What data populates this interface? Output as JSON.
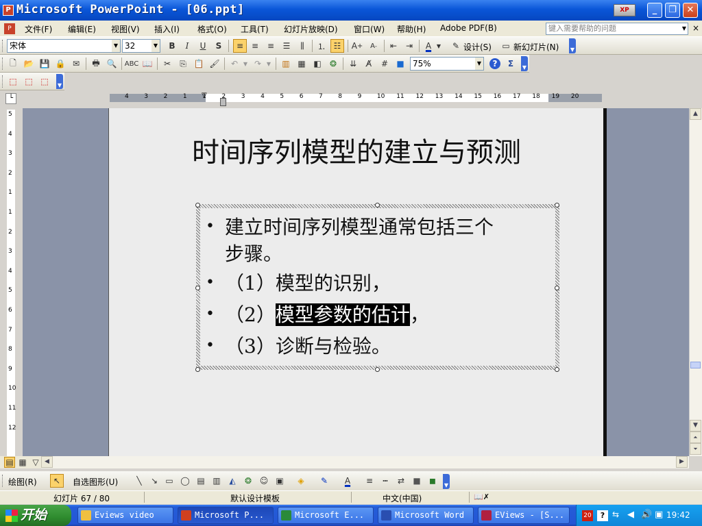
{
  "window": {
    "title": "Microsoft PowerPoint - [06.ppt]",
    "app_icon": "P"
  },
  "menu": {
    "items": [
      "文件(F)",
      "编辑(E)",
      "视图(V)",
      "插入(I)",
      "格式(O)",
      "工具(T)",
      "幻灯片放映(D)",
      "窗口(W)",
      "帮助(H)",
      "Adobe PDF(B)"
    ],
    "help_placeholder": "键入需要帮助的问题",
    "close_glyph": "×"
  },
  "format_toolbar": {
    "font": "宋体",
    "size": "32",
    "bold": "B",
    "italic": "I",
    "underline": "U",
    "shadow": "S",
    "design_label": "设计(S)",
    "new_slide_label": "新幻灯片(N)"
  },
  "standard_toolbar": {
    "zoom": "75%",
    "help": "?",
    "sigma": "Σ"
  },
  "ruler": {
    "h_labels": [
      "4",
      "3",
      "2",
      "1",
      "1",
      "2",
      "3",
      "4",
      "5",
      "6",
      "7",
      "8",
      "9",
      "10",
      "11",
      "12",
      "13",
      "14",
      "15",
      "16",
      "17",
      "18",
      "19",
      "20"
    ],
    "v_labels": [
      "5",
      "4",
      "3",
      "2",
      "1",
      "1",
      "2",
      "3",
      "4",
      "5",
      "6",
      "7",
      "8",
      "9",
      "10",
      "11",
      "12"
    ]
  },
  "slide": {
    "title": "时间序列模型的建立与预测",
    "bullets": [
      {
        "line1": "建立时间序列模型通常包括三个",
        "line2": "步骤。"
      },
      {
        "text": "（1）模型的识别，"
      },
      {
        "pre": "（2）",
        "highlight": "模型参数的估计",
        "post": "，"
      },
      {
        "text": "（3）诊断与检验。"
      }
    ],
    "bullet_glyph": "•"
  },
  "drawing_toolbar": {
    "draw_label": "绘图(R)",
    "autoshape_label": "自选图形(U)"
  },
  "status": {
    "slide": "幻灯片 67 / 80",
    "template": "默认设计模板",
    "language": "中文(中国)"
  },
  "taskbar": {
    "start": "开始",
    "tasks": [
      "Eviews video",
      "Microsoft P...",
      "Microsoft E...",
      "Microsoft Word",
      "EViews - [S..."
    ],
    "clock": "19:42"
  }
}
